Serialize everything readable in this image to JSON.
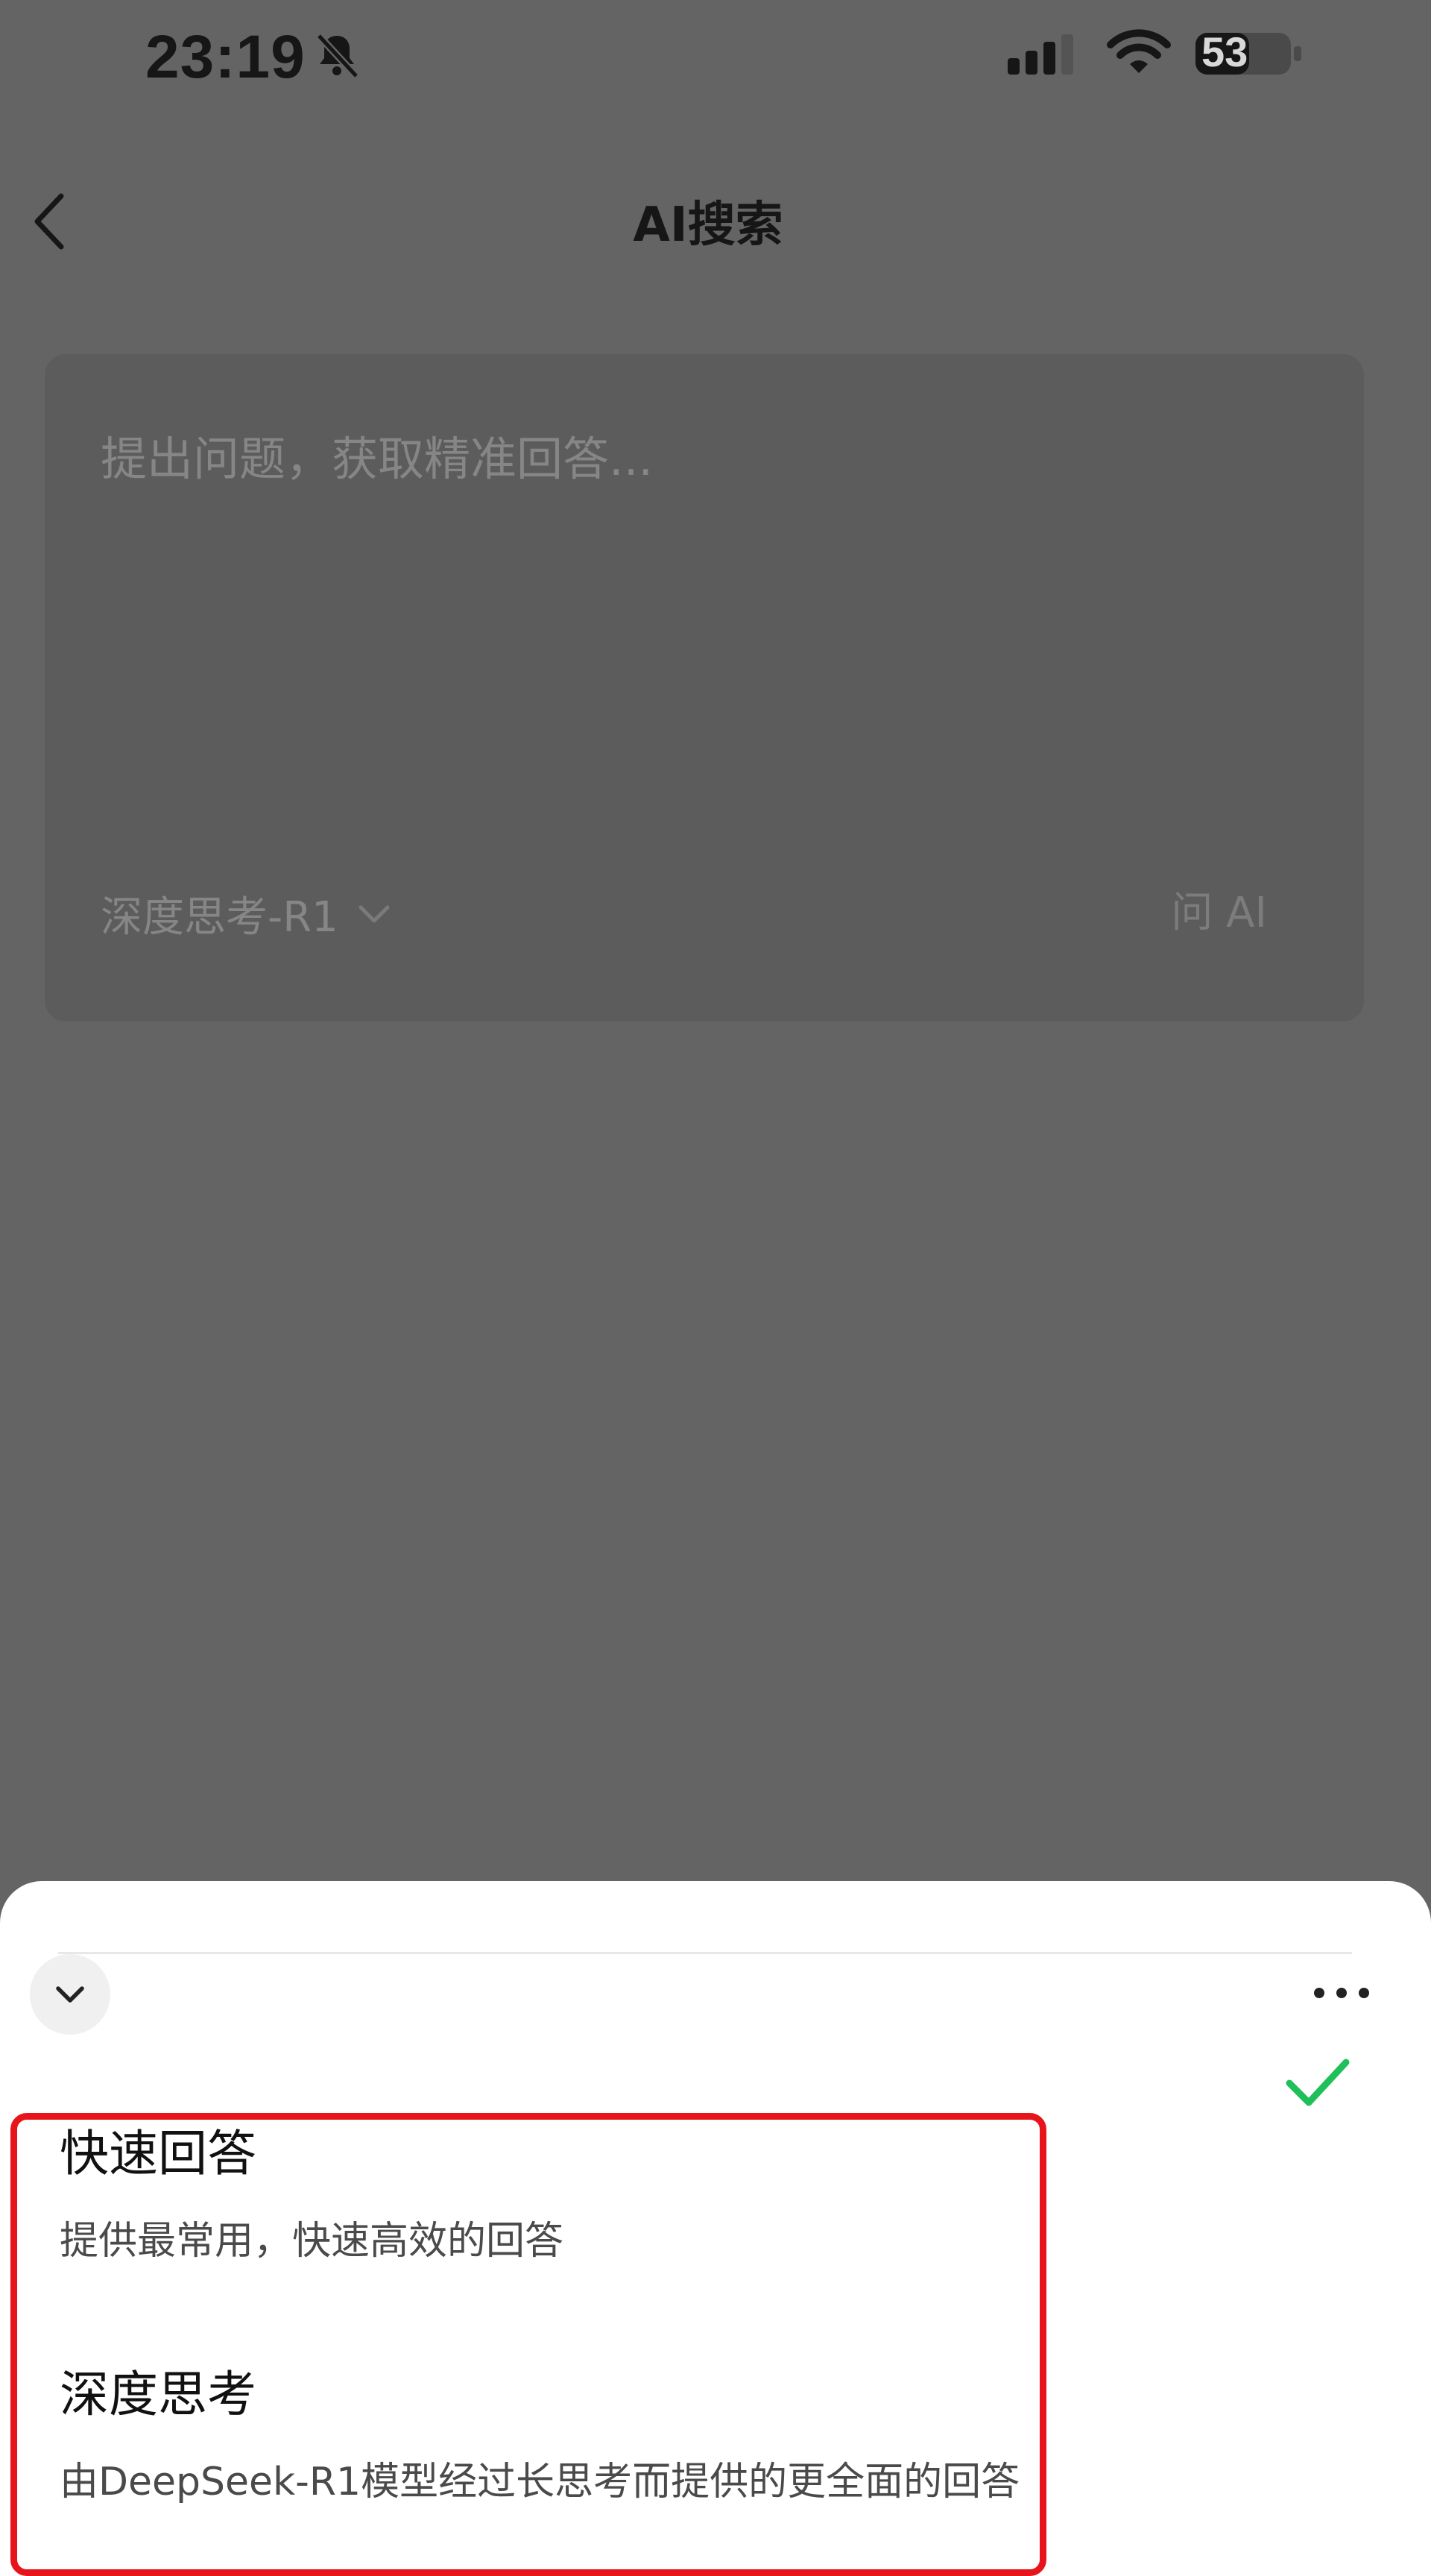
{
  "status_bar": {
    "time": "23:19",
    "battery": "53",
    "icons": [
      "bell-muted-icon",
      "signal-icon",
      "wifi-icon",
      "battery-icon"
    ]
  },
  "header": {
    "title": "AI搜索",
    "back_icon": "chevron-left-icon"
  },
  "query": {
    "placeholder": "提出问题，获取精准回答...",
    "model_label": "深度思考-R1",
    "ask_label": "问 AI"
  },
  "sheet": {
    "collapse_icon": "chevron-down-icon",
    "more_icon": "more-dots-icon",
    "options": [
      {
        "title": "快速回答",
        "description": "提供最常用，快速高效的回答",
        "selected": false
      },
      {
        "title": "深度思考",
        "description": "由DeepSeek-R1模型经过长思考而提供的更全面的回答",
        "selected": true
      }
    ]
  },
  "colors": {
    "overlay_background": "#646464",
    "sheet_background": "#ffffff",
    "highlight_border": "#e8141c",
    "check_color": "#1fc05a"
  }
}
